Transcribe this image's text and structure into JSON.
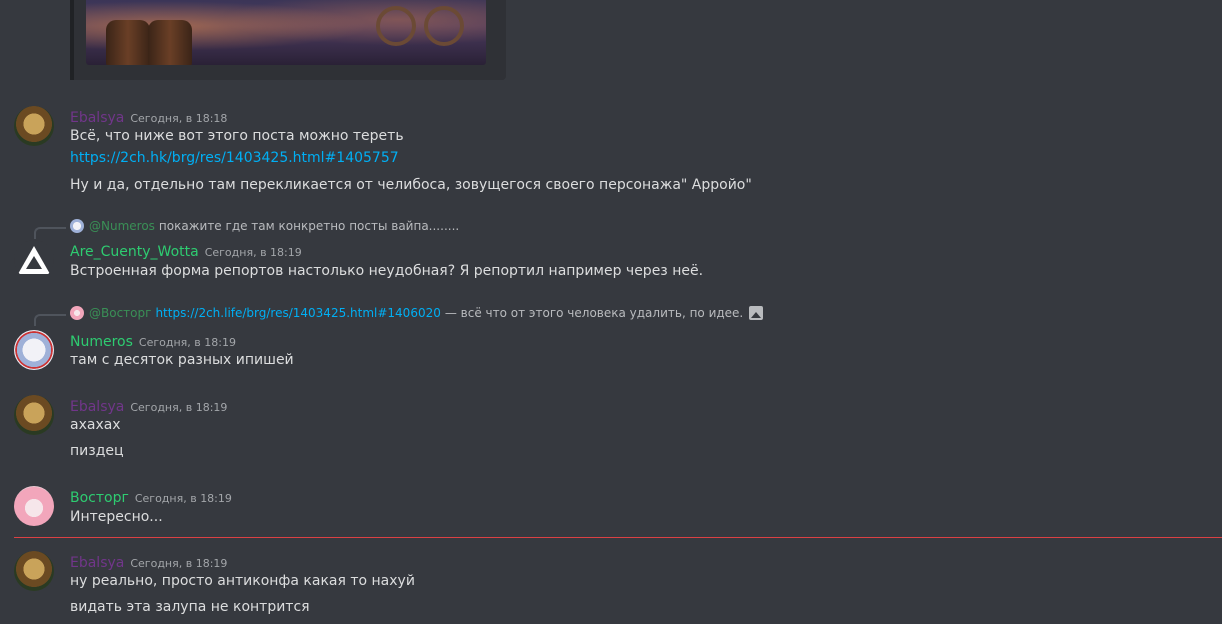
{
  "messages": [
    {
      "user": "Ebalsya",
      "time": "Сегодня, в 18:18",
      "lines": [
        "Всё, что ниже вот этого поста можно тереть",
        "https://2ch.hk/brg/res/1403425.html#1405757",
        "Ну и да, отдельно там перекликается от челибоса, зовущегося своего персонажа\" Арройо\""
      ]
    },
    {
      "reply": {
        "mention": "@Numeros",
        "text": "покажите где там конкретно посты вайпа........"
      },
      "user": "Are_Cuenty_Wotta",
      "time": "Сегодня, в 18:19",
      "lines": [
        "Встроенная форма репортов настолько неудобная? Я репортил например через неё."
      ]
    },
    {
      "reply": {
        "mention": "@Восторг",
        "link": "https://2ch.life/brg/res/1403425.html#1406020",
        "text": "— всё что от этого человека удалить, по идее."
      },
      "user": "Numeros",
      "time": "Сегодня, в 18:19",
      "lines": [
        "там с десяток разных ипишей"
      ]
    },
    {
      "user": "Ebalsya",
      "time": "Сегодня, в 18:19",
      "lines": [
        "ахахах",
        "пиздец"
      ]
    },
    {
      "user": "Восторг",
      "time": "Сегодня, в 18:19",
      "lines": [
        "Интересно..."
      ]
    },
    {
      "user": "Ebalsya",
      "time": "Сегодня, в 18:19",
      "lines": [
        "ну реально, просто антиконфа какая то нахуй",
        "видать эта залупа не контрится"
      ]
    }
  ],
  "icons": {
    "reply_image_indicator": "image-icon",
    "are_avatar": "triangle-logo-icon"
  },
  "colors": {
    "background": "#36393f",
    "name_purple": "#71368a",
    "name_green": "#2ecc71",
    "link": "#00aff4",
    "new_messages_divider": "#ed4245"
  }
}
